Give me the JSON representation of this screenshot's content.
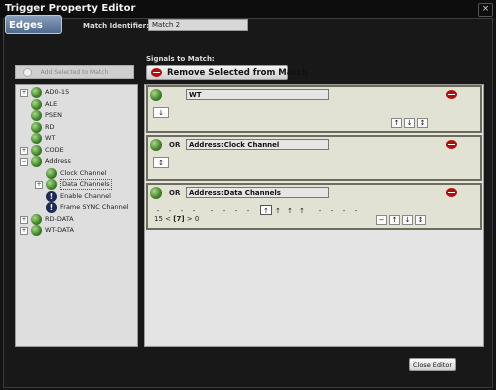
{
  "window": {
    "title": "Trigger Property Editor",
    "close_symbol": "×"
  },
  "tab": {
    "label": "Edges"
  },
  "match_identifier": {
    "label": "Match Identifier:",
    "value": "Match 2"
  },
  "add_button": {
    "label": "Add Selected to Match"
  },
  "tree": {
    "items": [
      {
        "label": "AD0-15",
        "icon": "green-ball-icon",
        "expander": "+"
      },
      {
        "label": "ALE",
        "icon": "green-ball-icon",
        "expander": ""
      },
      {
        "label": "PSEN",
        "icon": "green-ball-icon",
        "expander": ""
      },
      {
        "label": "RD",
        "icon": "green-ball-icon",
        "expander": ""
      },
      {
        "label": "WT",
        "icon": "green-ball-icon",
        "expander": ""
      },
      {
        "label": "CODE",
        "icon": "green-ball-icon",
        "expander": "+"
      },
      {
        "label": "Address",
        "icon": "green-ball-icon",
        "expander": "−"
      },
      {
        "label": "Clock Channel",
        "icon": "green-ball-icon",
        "expander": ""
      },
      {
        "label": "Data Channels",
        "icon": "green-ball-icon",
        "expander": "+"
      },
      {
        "label": "Enable Channel",
        "icon": "warning-icon",
        "expander": ""
      },
      {
        "label": "Frame SYNC Channel",
        "icon": "warning-icon",
        "expander": ""
      },
      {
        "label": "RD-DATA",
        "icon": "green-ball-icon",
        "expander": "+"
      },
      {
        "label": "WT-DATA",
        "icon": "green-ball-icon",
        "expander": "+"
      }
    ],
    "warning_glyph": "!"
  },
  "signals": {
    "label": "Signals to Match:",
    "remove_button": "Remove Selected from Match",
    "items": [
      {
        "connector": "",
        "name": "WT",
        "edge": "↓",
        "buttons": [
          "↑",
          "↓",
          "↕"
        ]
      },
      {
        "connector": "OR",
        "name": "Address:Clock Channel",
        "edge": "↕",
        "buttons": []
      },
      {
        "connector": "OR",
        "name": "Address:Data Channels",
        "bits": [
          "-",
          "-",
          "-",
          "-",
          "-",
          "-",
          "-",
          "-",
          "↑",
          "↑",
          "↑",
          "↑",
          "-",
          "-",
          "-",
          "-"
        ],
        "selected_bit": 8,
        "range": {
          "high": "15",
          "lt": "<",
          "current": "[7]",
          "gt": ">",
          "low": "0"
        },
        "buttons": [
          "−",
          "↑",
          "↓",
          "↕"
        ]
      }
    ]
  },
  "close_editor": {
    "label": "Close Editor"
  }
}
